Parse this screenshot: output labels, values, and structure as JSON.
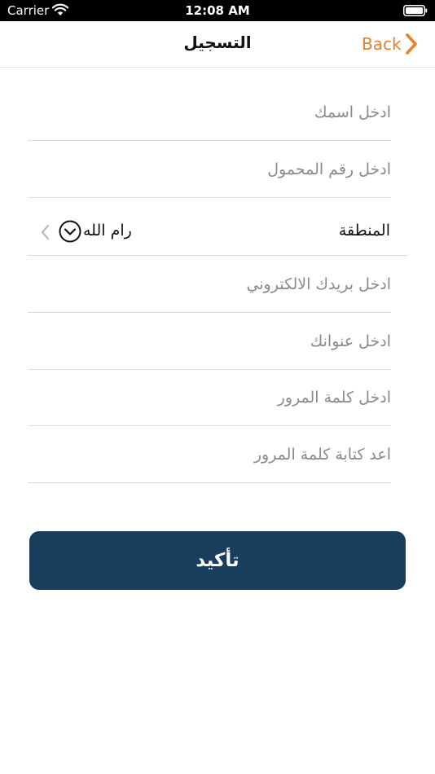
{
  "status_bar": {
    "carrier": "Carrier",
    "time": "12:08 AM"
  },
  "nav": {
    "title": "التسجيل",
    "back_label": "Back",
    "accent_color": "#e8822a"
  },
  "form": {
    "name_placeholder": "ادخل اسمك",
    "mobile_placeholder": "ادخل رقم المحمول",
    "region_label": "المنطقة",
    "region_value": "رام الله",
    "email_placeholder": "ادخل بريدك الالكتروني",
    "address_placeholder": "ادخل عنوانك",
    "password_placeholder": "ادخل كلمة المرور",
    "password_confirm_placeholder": "اعد كتابة كلمة المرور"
  },
  "confirm": {
    "label": "تأكيد",
    "color": "#193d5c"
  }
}
